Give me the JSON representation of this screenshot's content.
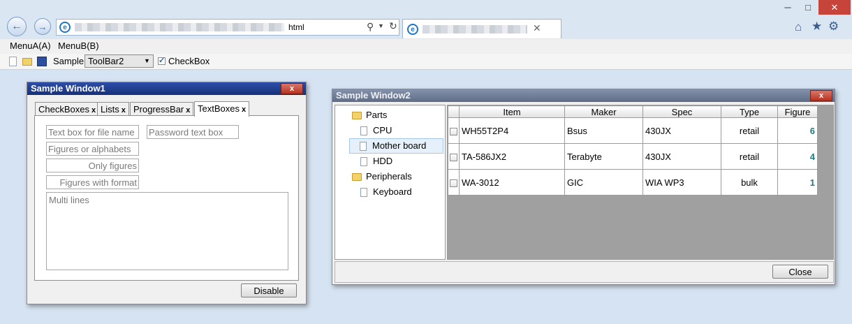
{
  "browser": {
    "address_suffix": "html",
    "window_controls": {
      "minimize": "─",
      "maximize": "□",
      "close": "✕"
    },
    "toolbar_icons": [
      "home-icon",
      "favorites-star-icon",
      "settings-gear-icon"
    ]
  },
  "menu": {
    "items": [
      "MenuA(A)",
      "MenuB(B)"
    ]
  },
  "toolbar": {
    "sample_label": "Sample",
    "combo_value": "ToolBar2",
    "checkbox_label": "CheckBox",
    "checkbox_checked": true
  },
  "window1": {
    "title": "Sample Window1",
    "close": "x",
    "tabs": [
      {
        "label": "CheckBoxes",
        "close": "x"
      },
      {
        "label": "Lists",
        "close": "x"
      },
      {
        "label": "ProgressBar",
        "close": "x"
      },
      {
        "label": "TextBoxes",
        "close": "x"
      }
    ],
    "fields": {
      "file_name": "Text box for file name",
      "password": "Password text box",
      "alpha": "Figures or alphabets",
      "figures": "Only figures",
      "format": "Figures with format",
      "multiline": "Multi lines"
    },
    "disable_button": "Disable"
  },
  "window2": {
    "title": "Sample Window2",
    "close": "x",
    "tree": [
      {
        "label": "Parts",
        "kind": "folder",
        "indent": 0
      },
      {
        "label": "CPU",
        "kind": "doc",
        "indent": 1
      },
      {
        "label": "Mother board",
        "kind": "doc",
        "indent": 1,
        "selected": true
      },
      {
        "label": "HDD",
        "kind": "doc",
        "indent": 1
      },
      {
        "label": "Peripherals",
        "kind": "folder",
        "indent": 0
      },
      {
        "label": "Keyboard",
        "kind": "doc",
        "indent": 1
      }
    ],
    "grid": {
      "columns": [
        "Item",
        "Maker",
        "Spec",
        "Type",
        "Figure"
      ],
      "rows": [
        {
          "item": "WH55T2P4",
          "maker": "Bsus",
          "spec": "430JX",
          "type": "retail",
          "figure": "6"
        },
        {
          "item": "TA-586JX2",
          "maker": "Terabyte",
          "spec": "430JX",
          "type": "retail",
          "figure": "4"
        },
        {
          "item": "WA-3012",
          "maker": "GIC",
          "spec": "WIA WP3",
          "type": "bulk",
          "figure": "1"
        }
      ]
    },
    "close_button": "Close"
  },
  "colors": {
    "title_active": "#1f3b8c",
    "title_inactive": "#6f7f99",
    "figure_text": "#207a86",
    "grid_empty": "#a0a0a0"
  }
}
